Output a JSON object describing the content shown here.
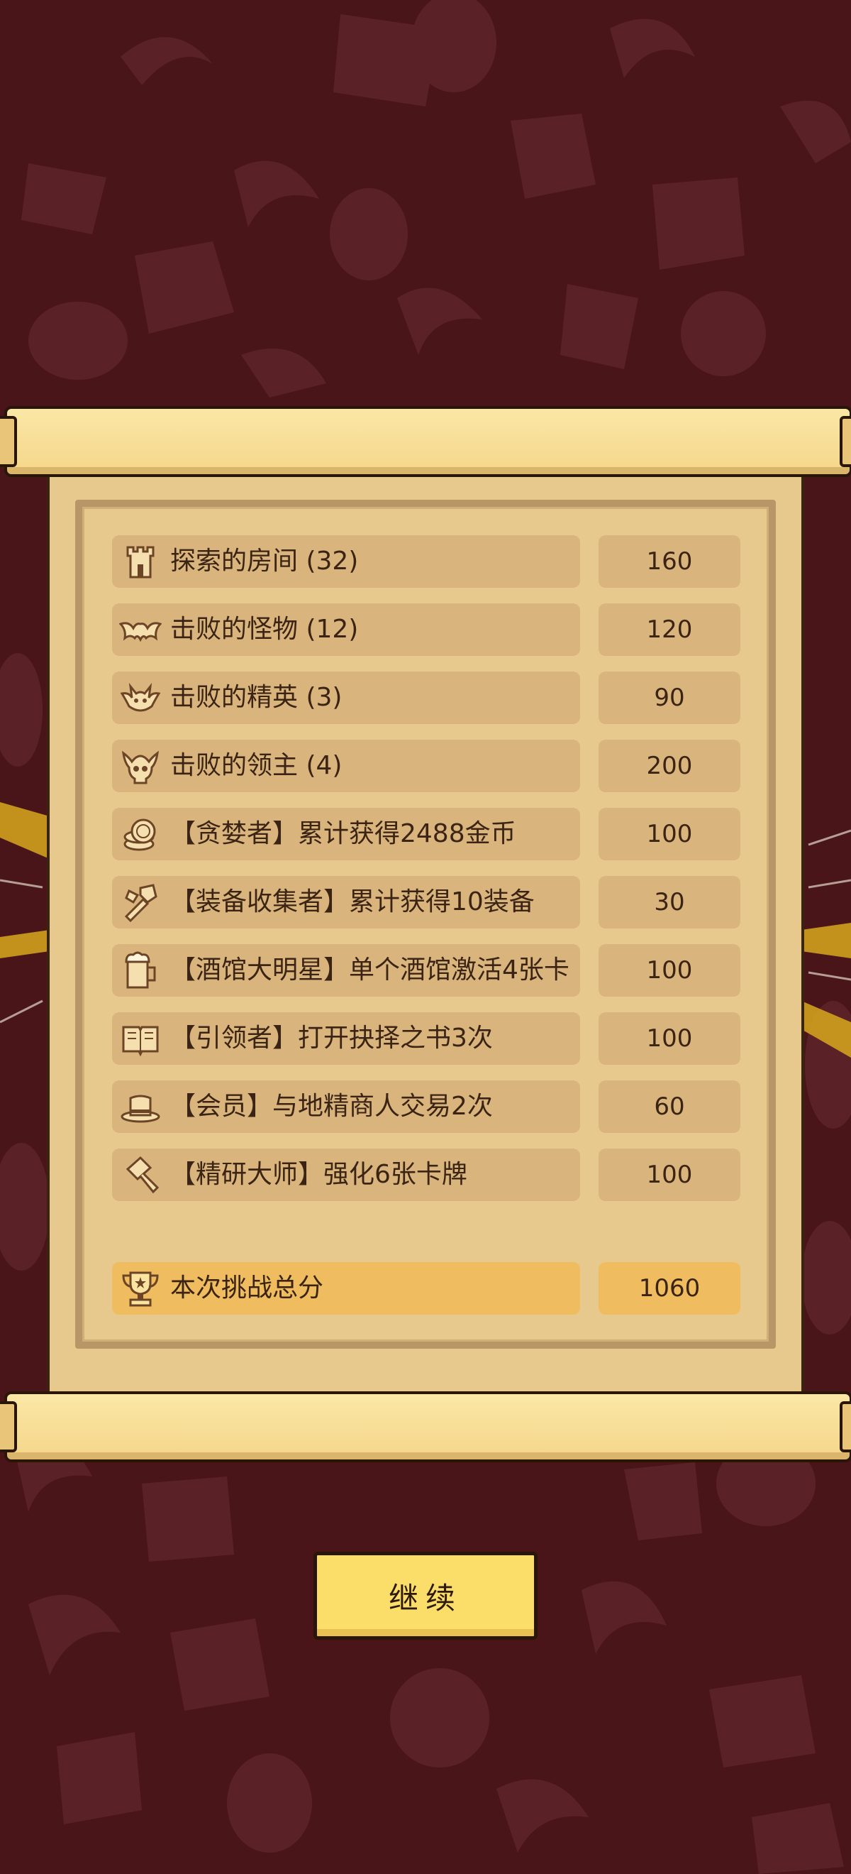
{
  "rows": [
    {
      "label": "探索的房间 (32)",
      "value": "160",
      "icon": "tower-icon"
    },
    {
      "label": "击败的怪物 (12)",
      "value": "120",
      "icon": "bat-icon"
    },
    {
      "label": "击败的精英 (3)",
      "value": "90",
      "icon": "demon-icon"
    },
    {
      "label": "击败的领主 (4)",
      "value": "200",
      "icon": "boss-skull-icon"
    },
    {
      "label": "【贪婪者】累计获得2488金币",
      "value": "100",
      "icon": "coins-icon"
    },
    {
      "label": "【装备收集者】累计获得10装备",
      "value": "30",
      "icon": "equipment-icon"
    },
    {
      "label": "【酒馆大明星】单个酒馆激活4张卡",
      "value": "100",
      "icon": "beer-mug-icon"
    },
    {
      "label": "【引领者】打开抉择之书3次",
      "value": "100",
      "icon": "book-icon"
    },
    {
      "label": "【会员】与地精商人交易2次",
      "value": "60",
      "icon": "top-hat-icon"
    },
    {
      "label": "【精研大师】强化6张卡牌",
      "value": "100",
      "icon": "hammer-icon"
    }
  ],
  "total": {
    "label": "本次挑战总分",
    "value": "1060",
    "icon": "trophy-icon"
  },
  "continue_label": "继续",
  "colors": {
    "background": "#4a1519",
    "parchment": "#e7c98e",
    "row": "#d9b57d",
    "total_row": "#efbd5f",
    "button": "#fbdd6a"
  }
}
